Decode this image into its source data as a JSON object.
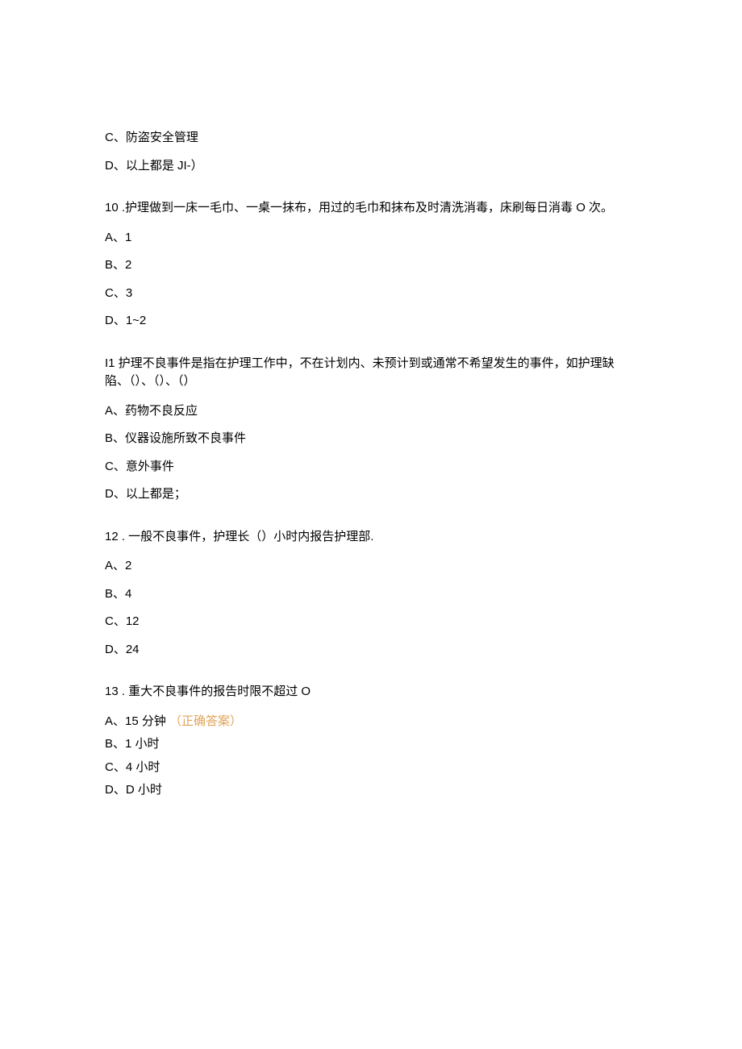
{
  "orphanOptions": [
    "C、防盗安全管理",
    "D、以上都是 JI-）"
  ],
  "q10": {
    "stem": "10 .护理做到一床一毛巾、一桌一抹布，用过的毛巾和抹布及时清洗消毒，床刷每日消毒 O 次。",
    "A": "A、1",
    "B": "B、2",
    "C": "C、3",
    "D": "D、1~2"
  },
  "q11": {
    "stem": "I1 护理不良事件是指在护理工作中，不在计划内、未预计到或通常不希望发生的事件，如护理缺陷、（）、（）、（）",
    "A": "A、药物不良反应",
    "B": "B、仪器设施所致不良事件",
    "C": "C、意外事件",
    "D": "D、以上都是；"
  },
  "q12": {
    "stem": "12 . 一般不良事件，护理长（）小时内报告护理部.",
    "A": "A、2",
    "B": "B、4",
    "C": "C、12",
    "D": "D、24"
  },
  "q13": {
    "stem": "13 . 重大不良事件的报告时限不超过 O",
    "A": "A、15 分钟",
    "Acorrect": "（正确答案）",
    "B": "B、1 小时",
    "C": "C、4 小时",
    "D": "D、D 小时"
  }
}
